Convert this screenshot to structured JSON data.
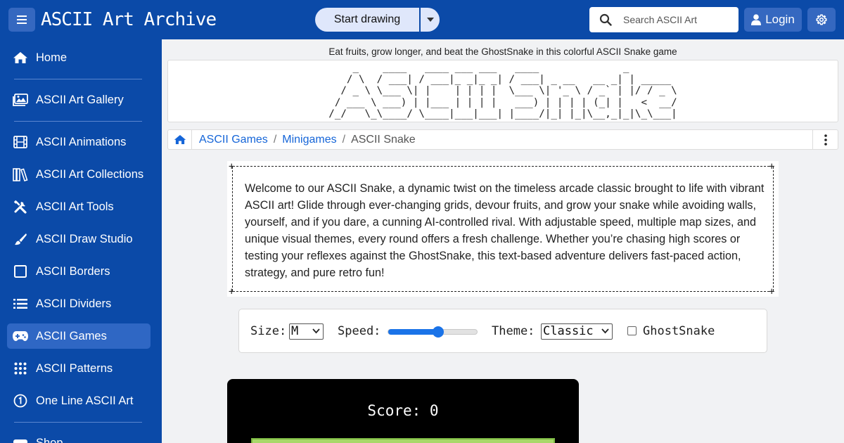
{
  "header": {
    "site_title": "ASCII Art Archive",
    "start_label": "Start drawing",
    "search_placeholder": "Search ASCII Art",
    "login_label": "Login"
  },
  "sidebar": {
    "items": [
      {
        "label": "Home",
        "icon": "home-icon"
      },
      {
        "label": "ASCII Art Gallery",
        "icon": "gallery-icon"
      },
      {
        "label": "ASCII Animations",
        "icon": "film-icon"
      },
      {
        "label": "ASCII Art Collections",
        "icon": "books-icon"
      },
      {
        "label": "ASCII Art Tools",
        "icon": "tools-icon"
      },
      {
        "label": "ASCII Draw Studio",
        "icon": "brush-icon"
      },
      {
        "label": "ASCII Borders",
        "icon": "square-icon"
      },
      {
        "label": "ASCII Dividers",
        "icon": "dividers-icon"
      },
      {
        "label": "ASCII Games",
        "icon": "gamepad-icon",
        "active": true
      },
      {
        "label": "ASCII Patterns",
        "icon": "grid-dots-icon"
      },
      {
        "label": "One Line ASCII Art",
        "icon": "one-circle-icon"
      },
      {
        "label": "Shop",
        "icon": "shop-icon"
      }
    ]
  },
  "page": {
    "tagline": "Eat fruits, grow longer, and beat the GhostSnake in this colorful ASCII Snake game",
    "banner_ascii": "    _    ____   ____ ___ ___   ____              _        \n   / \\  / ___| / ___|_ _|_ _| / ___| _ __   __ _| | _____ \n  / _ \\ \\___ \\| |    | | | |  \\___ \\| '_ \\ / _` | |/ / _ \\\n / ___ \\ ___) | |___ | | | |   ___) | | | | (_| |   <  __/\n/_/   \\_\\____/ \\____|___|___| |____/|_| |_|\\__,_|_|\\_\\___|",
    "breadcrumb": {
      "link1": "ASCII Games",
      "link2": "Minigames",
      "current": "ASCII Snake",
      "separator": "/"
    },
    "description": "Welcome to our ASCII Snake, a dynamic twist on the timeless arcade classic brought to life with vibrant ASCII art! Glide through ever-changing grids, devour fruits, and grow your snake while avoiding walls, yourself, and if you dare, a cunning AI-controlled rival. With adjustable speed, multiple map sizes, and unique visual themes, every round offers a fresh challenge. Whether you’re chasing high scores or testing your reflexes against the GhostSnake, this text-based adventure delivers fast-paced action, strategy, and pure retro fun!"
  },
  "controls": {
    "size_label": "Size:",
    "size_value": "M",
    "speed_label": "Speed:",
    "speed_fraction": 0.57,
    "theme_label": "Theme:",
    "theme_value": "Classic",
    "ghost_label": "GhostSnake",
    "ghost_checked": false
  },
  "game": {
    "score_text": "Score: 0"
  },
  "colors": {
    "brand": "#0b4aa8",
    "link": "#1565d8",
    "field": "#a8d86a"
  }
}
